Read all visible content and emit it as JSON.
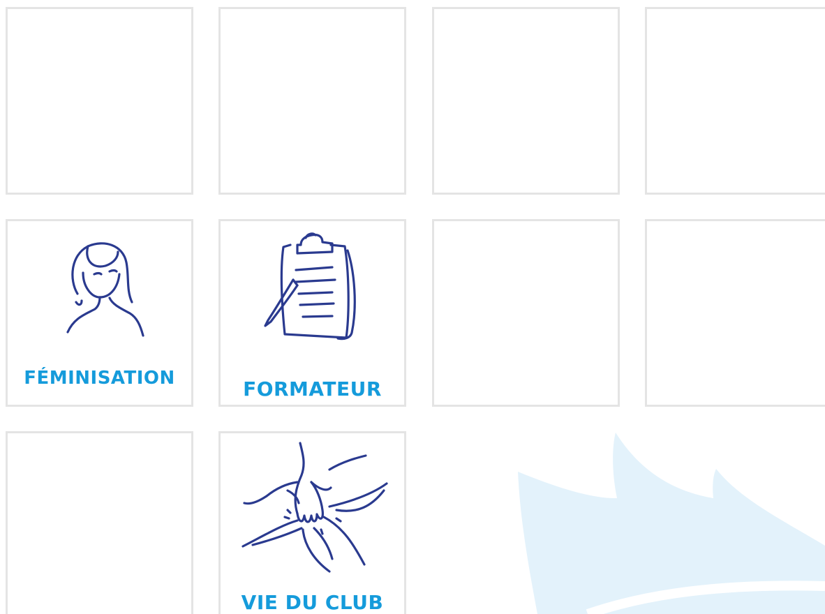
{
  "tiles": {
    "feminisation": {
      "label": "FÉMINISATION"
    },
    "formateur": {
      "label": "FORMATEUR"
    },
    "vie_du_club": {
      "label": "VIE DU CLUB"
    }
  },
  "colors": {
    "label_blue": "#159bdb",
    "icon_navy": "#2a3a8f",
    "tile_border": "#e4e4e4",
    "background_logo": "#e3f2fb"
  },
  "icons": {
    "feminisation": "woman-portrait-icon",
    "formateur": "clipboard-pen-icon",
    "vie_du_club": "joined-hands-icon"
  }
}
